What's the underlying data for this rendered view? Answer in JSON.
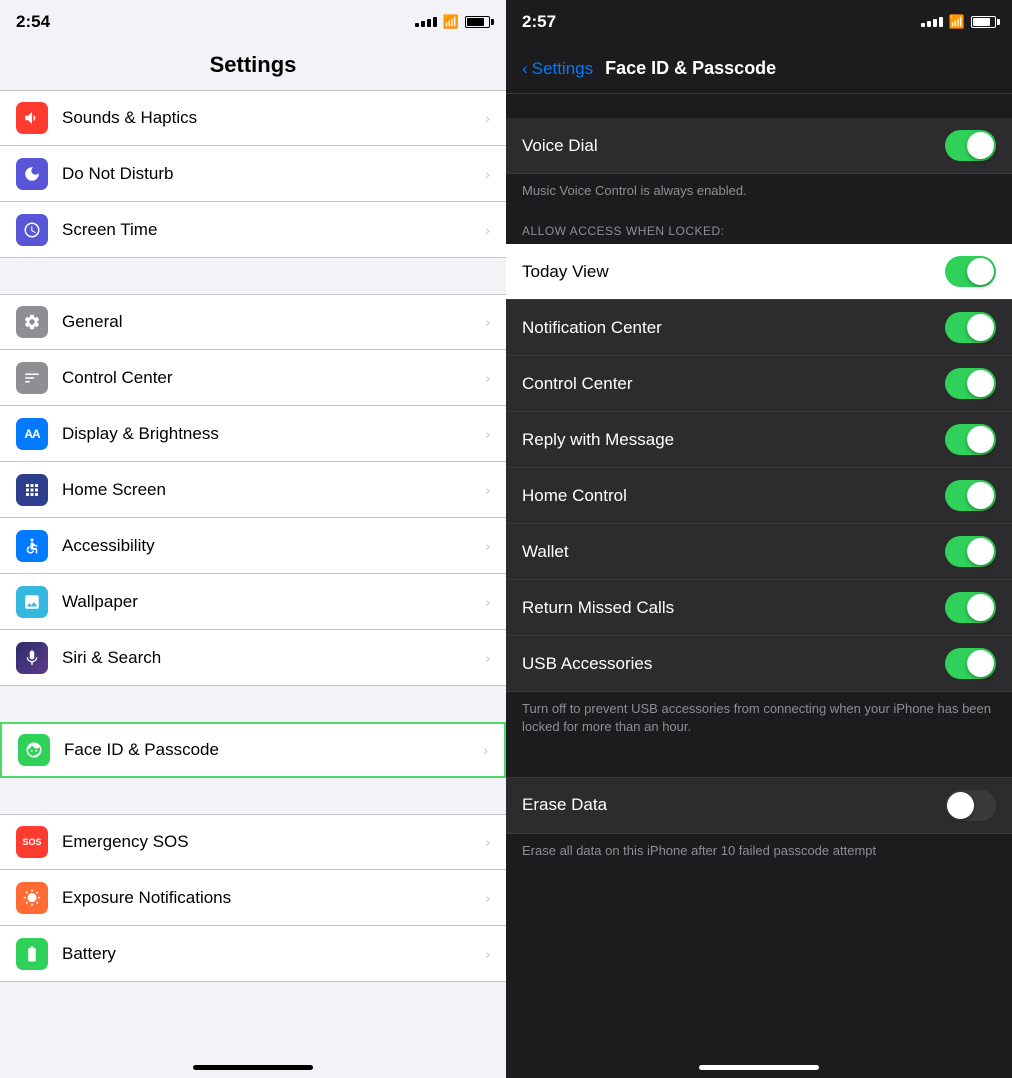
{
  "left": {
    "status": {
      "time": "2:54"
    },
    "title": "Settings",
    "items": [
      {
        "id": "sounds",
        "label": "Sounds & Haptics",
        "iconClass": "icon-sounds",
        "iconSymbol": "🔊"
      },
      {
        "id": "dnd",
        "label": "Do Not Disturb",
        "iconClass": "icon-dnd",
        "iconSymbol": "🌙"
      },
      {
        "id": "screentime",
        "label": "Screen Time",
        "iconClass": "icon-screentime",
        "iconSymbol": "⏳"
      },
      {
        "id": "general",
        "label": "General",
        "iconClass": "icon-general",
        "iconSymbol": "⚙️"
      },
      {
        "id": "control",
        "label": "Control Center",
        "iconClass": "icon-control",
        "iconSymbol": "🔧"
      },
      {
        "id": "display",
        "label": "Display & Brightness",
        "iconClass": "icon-display",
        "iconSymbol": "AA"
      },
      {
        "id": "homescreen",
        "label": "Home Screen",
        "iconClass": "icon-homescreen",
        "iconSymbol": "⠿"
      },
      {
        "id": "accessibility",
        "label": "Accessibility",
        "iconClass": "icon-accessibility",
        "iconSymbol": "♿"
      },
      {
        "id": "wallpaper",
        "label": "Wallpaper",
        "iconClass": "icon-wallpaper",
        "iconSymbol": "❄"
      },
      {
        "id": "siri",
        "label": "Siri & Search",
        "iconClass": "icon-siri",
        "iconSymbol": "🎙"
      },
      {
        "id": "faceid",
        "label": "Face ID & Passcode",
        "iconClass": "icon-faceid",
        "iconSymbol": "😊",
        "selected": true
      },
      {
        "id": "sos",
        "label": "Emergency SOS",
        "iconClass": "icon-sos",
        "iconSymbol": "SOS"
      },
      {
        "id": "exposure",
        "label": "Exposure Notifications",
        "iconClass": "icon-exposure",
        "iconSymbol": "☀"
      },
      {
        "id": "battery",
        "label": "Battery",
        "iconClass": "icon-battery",
        "iconSymbol": "🔋"
      }
    ]
  },
  "right": {
    "status": {
      "time": "2:57"
    },
    "nav": {
      "back_label": "Settings",
      "title": "Face ID & Passcode"
    },
    "sections": {
      "voice_dial": {
        "label": "Voice Dial",
        "toggle": "on",
        "footer": "Music Voice Control is always enabled."
      },
      "allow_access_header": "ALLOW ACCESS WHEN LOCKED:",
      "items": [
        {
          "id": "today_view",
          "label": "Today View",
          "toggle": "on",
          "highlighted": true
        },
        {
          "id": "notification_center",
          "label": "Notification Center",
          "toggle": "on"
        },
        {
          "id": "control_center",
          "label": "Control Center",
          "toggle": "on"
        },
        {
          "id": "reply_message",
          "label": "Reply with Message",
          "toggle": "on"
        },
        {
          "id": "home_control",
          "label": "Home Control",
          "toggle": "on"
        },
        {
          "id": "wallet",
          "label": "Wallet",
          "toggle": "on"
        },
        {
          "id": "return_missed_calls",
          "label": "Return Missed Calls",
          "toggle": "on"
        },
        {
          "id": "usb_accessories",
          "label": "USB Accessories",
          "toggle": "on"
        }
      ],
      "usb_footer": "Turn off to prevent USB accessories from connecting when your iPhone has been locked for more than an hour.",
      "erase_data": {
        "label": "Erase Data",
        "toggle": "off"
      },
      "erase_footer": "Erase all data on this iPhone after 10 failed passcode attempt"
    }
  }
}
